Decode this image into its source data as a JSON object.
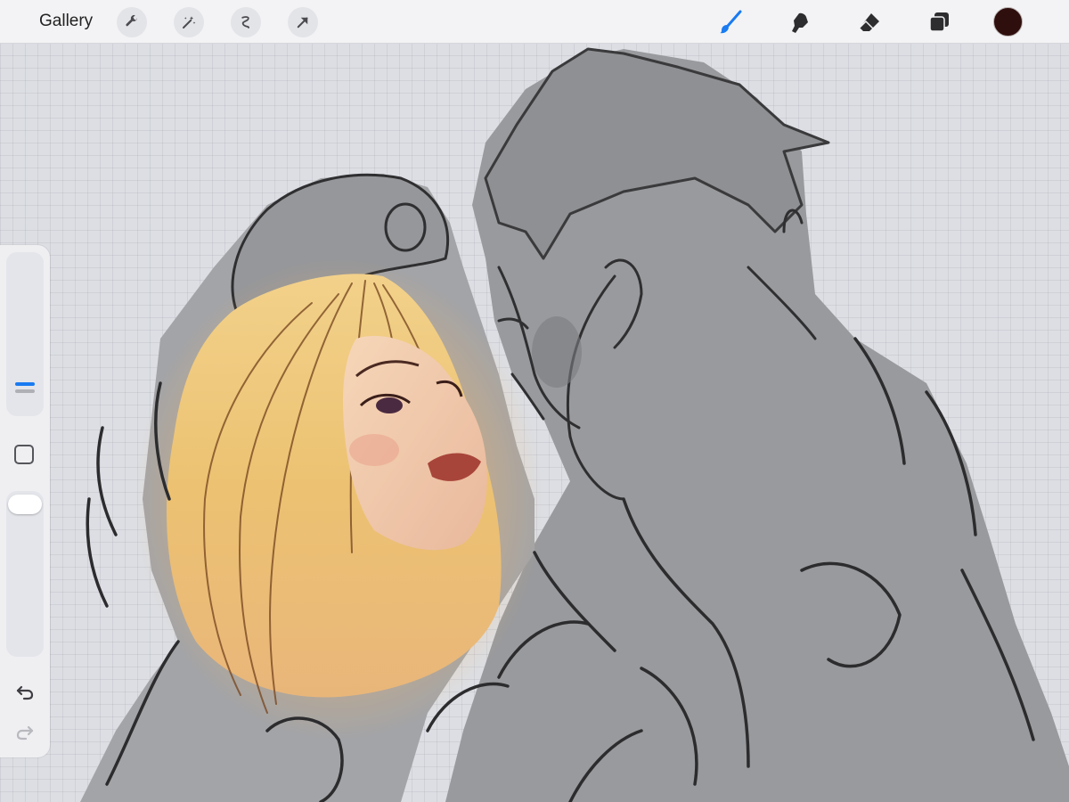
{
  "toolbar": {
    "gallery_label": "Gallery",
    "left_tools": [
      "wrench-icon",
      "magic-wand-icon",
      "selection-icon",
      "transform-arrow-icon"
    ],
    "right_tools": [
      "brush-icon",
      "smudge-icon",
      "eraser-icon",
      "layers-icon"
    ],
    "active_tool": "brush-icon",
    "accent_color": "#1a7bf2",
    "current_color": "#2f0f0e"
  },
  "sidebar": {
    "brush_size_slider": "brush-size",
    "opacity_slider": "opacity",
    "modify_button": "modify",
    "undo": "undo-icon",
    "redo": "redo-icon",
    "redo_enabled": false
  },
  "canvas": {
    "background": "#dcdee3",
    "grid": true
  }
}
